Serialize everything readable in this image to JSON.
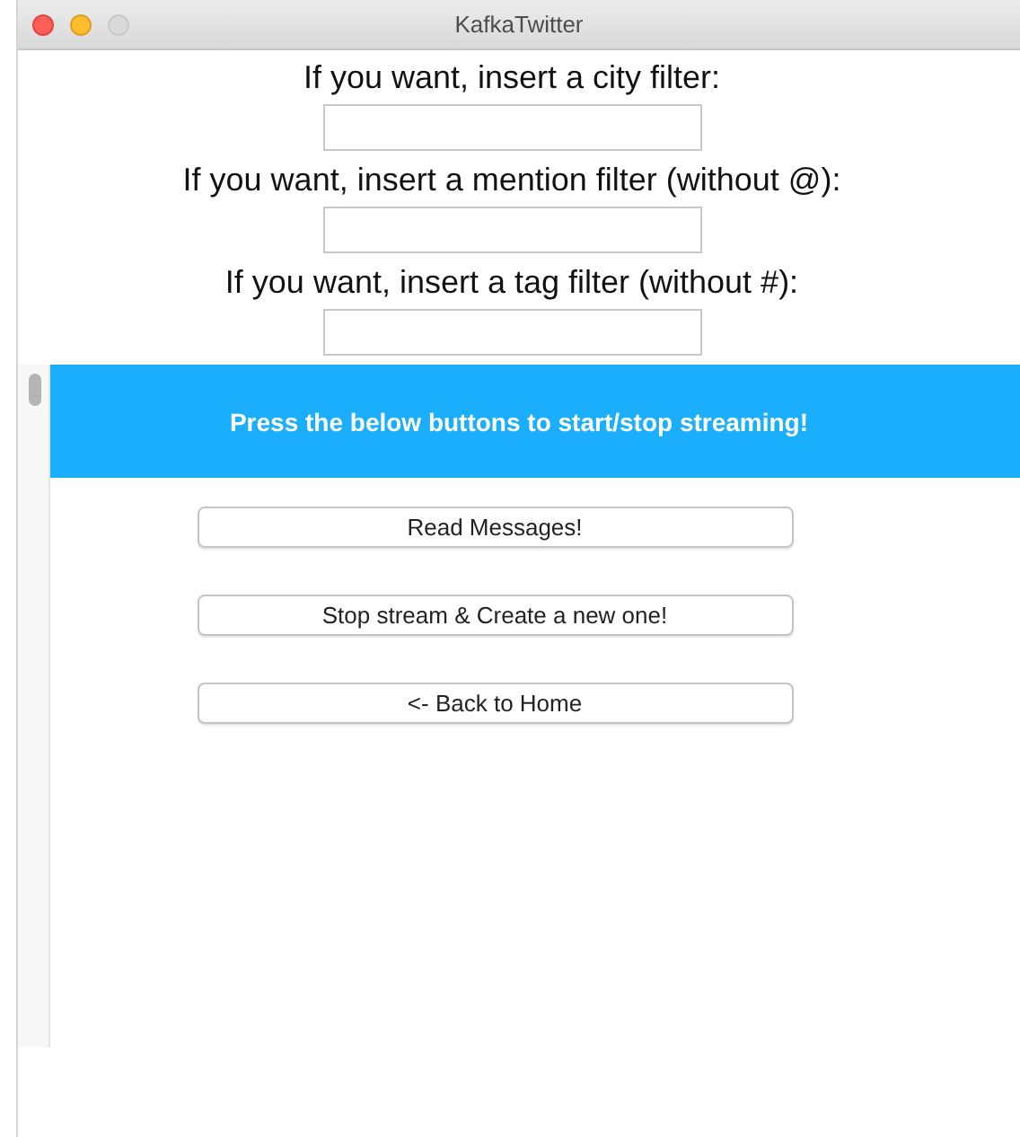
{
  "window": {
    "title": "KafkaTwitter"
  },
  "filters": [
    {
      "label": "If you want, insert a city filter:"
    },
    {
      "label": "If you want, insert a mention filter (without @):"
    },
    {
      "label": "If you want, insert a tag filter (without #):"
    }
  ],
  "banner": {
    "text": "Press the below buttons to start/stop streaming!"
  },
  "buttons": [
    "Read Messages!",
    "Stop stream & Create a new one!",
    "<- Back to Home"
  ]
}
